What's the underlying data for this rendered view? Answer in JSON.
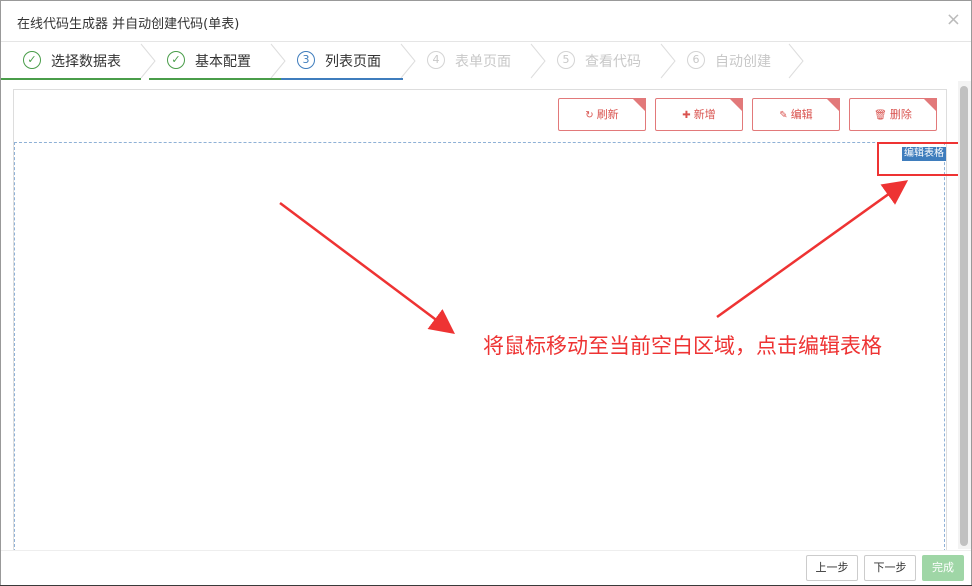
{
  "dialog": {
    "title": "在线代码生成器 并自动创建代码(单表)",
    "close_glyph": "×"
  },
  "wizard": {
    "steps": [
      {
        "num": "✓",
        "label": "选择数据表",
        "state": "done"
      },
      {
        "num": "✓",
        "label": "基本配置",
        "state": "done"
      },
      {
        "num": "3",
        "label": "列表页面",
        "state": "active"
      },
      {
        "num": "4",
        "label": "表单页面",
        "state": "todo"
      },
      {
        "num": "5",
        "label": "查看代码",
        "state": "todo"
      },
      {
        "num": "6",
        "label": "自动创建",
        "state": "todo"
      }
    ]
  },
  "toolbar": {
    "refresh": {
      "icon": "↻",
      "label": "刷新"
    },
    "add": {
      "icon": "✚",
      "label": "新增"
    },
    "edit": {
      "icon": "✎",
      "label": "编辑"
    },
    "delete": {
      "icon": "🗑",
      "label": "删除"
    }
  },
  "table": {
    "edit_table_label": "编辑表格"
  },
  "annotation": {
    "text": "将鼠标移动至当前空白区域，点击编辑表格"
  },
  "footer": {
    "prev_label": "上一步",
    "next_label": "下一步",
    "finish_label": "完成"
  },
  "colors": {
    "done": "#4a9d4a",
    "active": "#3f7dbd",
    "todo": "#c8c8c8",
    "toolbar_red": "#d9534f",
    "annotation_red": "#e33333",
    "finish_green": "#9fd6a6"
  }
}
